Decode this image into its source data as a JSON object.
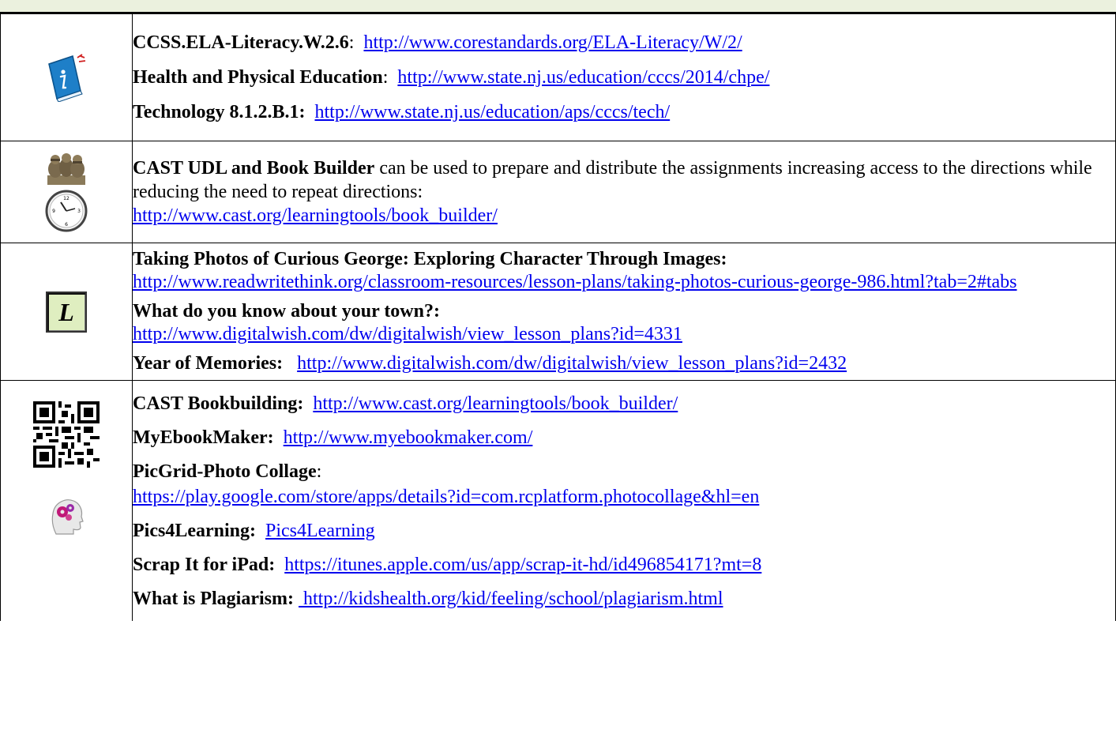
{
  "rows": {
    "standards": {
      "icon": "information-book-icon",
      "items": [
        {
          "label": "CCSS.ELA-Literacy.W.2.6",
          "sep": ":",
          "link": "http://www.corestandards.org/ELA-Literacy/W/2/"
        },
        {
          "label": "Health and Physical Education",
          "sep": ":",
          "link": "http://www.state.nj.us/education/cccs/2014/chpe/"
        },
        {
          "label": "Technology 8.1.2.B.1:",
          "sep": "",
          "link": "http://www.state.nj.us/education/aps/cccs/tech/"
        }
      ]
    },
    "udl": {
      "icons": [
        "three-monkeys-icon",
        "clock-icon"
      ],
      "label": "CAST UDL and Book Builder",
      "text": " can be used to prepare and distribute the assignments increasing access to the directions while reducing the need to repeat directions:",
      "link": "http://www.cast.org/learningtools/book_builder/"
    },
    "lessons": {
      "icon": "lesson-letter-icon",
      "icon_letter": "L",
      "items": [
        {
          "label": "Taking Photos of Curious George: Exploring Character Through Images:",
          "link": "http://www.readwritethink.org/classroom-resources/lesson-plans/taking-photos-curious-george-986.html?tab=2#tabs"
        },
        {
          "label": "What do you know about your town?:",
          "link": "http://www.digitalwish.com/dw/digitalwish/view_lesson_plans?id=4331"
        },
        {
          "label": "Year of Memories:",
          "link": "http://www.digitalwish.com/dw/digitalwish/view_lesson_plans?id=2432"
        }
      ]
    },
    "tools": {
      "icons": [
        "qr-code-icon",
        "head-gears-icon"
      ],
      "items": [
        {
          "label": "CAST Bookbuilding:",
          "link": "http://www.cast.org/learningtools/book_builder/"
        },
        {
          "label": "MyEbookMaker:",
          "link": "http://www.myebookmaker.com/"
        },
        {
          "label": "PicGrid-Photo Collage",
          "sep": ":",
          "link": "https://play.google.com/store/apps/details?id=com.rcplatform.photocollage&hl=en"
        },
        {
          "label": "Pics4Learning:",
          "link": "Pics4Learning"
        },
        {
          "label": "Scrap It for iPad:",
          "link": "https://itunes.apple.com/us/app/scrap-it-hd/id496854171?mt=8"
        },
        {
          "label": "What is Plagiarism:",
          "link": " http://kidshealth.org/kid/feeling/school/plagiarism.html"
        }
      ]
    }
  },
  "colors": {
    "link": "#0000ee",
    "band": "#ebf1de",
    "border": "#000000"
  }
}
